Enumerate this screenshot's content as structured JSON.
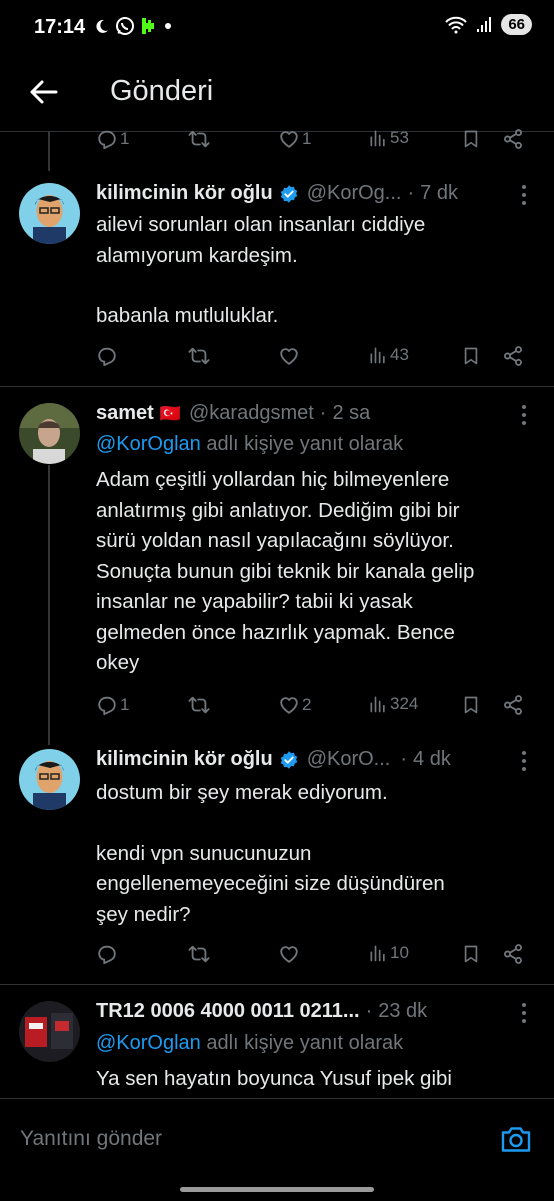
{
  "status_bar": {
    "time": "17:14",
    "battery": "66"
  },
  "header": {
    "title": "Gönderi"
  },
  "top_actions": {
    "replies": "1",
    "likes": "1",
    "views": "53"
  },
  "tweets": [
    {
      "name": "kilimcinin kör oğlu",
      "handle": "@KorOg...",
      "time": "7 dk",
      "verified": true,
      "body": [
        "ailevi sorunları olan insanları ciddiye",
        "alamıyorum kardeşim.",
        "",
        "babanla mutluluklar."
      ],
      "replies": "",
      "reposts": "",
      "likes": "",
      "views": "43"
    },
    {
      "name": "samet",
      "flag": "🇹🇷",
      "handle": "@karadgsmet",
      "time": "2 sa",
      "reply_to_mention": "@KorOglan",
      "reply_to_suffix": "adlı kişiye yanıt olarak",
      "body": [
        "Adam çeşitli yollardan hiç bilmeyenlere",
        "anlatırmış gibi anlatıyor. Dediğim gibi bir",
        "sürü yoldan nasıl yapılacağını söylüyor.",
        "Sonuçta bunun gibi teknik bir kanala gelip",
        "insanlar ne yapabilir? tabii ki yasak",
        "gelmeden önce hazırlık yapmak. Bence",
        "okey"
      ],
      "replies": "1",
      "reposts": "",
      "likes": "2",
      "views": "324"
    },
    {
      "name": "kilimcinin kör oğlu",
      "handle": "@KorO...",
      "time": "4 dk",
      "verified": true,
      "body": [
        "dostum bir şey merak ediyorum.",
        "",
        "kendi vpn sunucunuzun",
        "engellenemeyeceğini size düşündüren",
        "şey nedir?"
      ],
      "replies": "",
      "reposts": "",
      "likes": "",
      "views": "10"
    },
    {
      "name": "TR12 0006 4000 0011 0211...",
      "time": "23 dk",
      "reply_to_mention": "@KorOglan",
      "reply_to_suffix": "adlı kişiye yanıt olarak",
      "body": [
        "Ya sen hayatın boyunca Yusuf ipek gibi"
      ]
    }
  ],
  "composer": {
    "placeholder": "Yanıtını gönder"
  },
  "colors": {
    "background": "#000000",
    "text": "#e7e9ea",
    "muted": "#71767b",
    "accent": "#1d9bf0",
    "divider": "#2f3336"
  },
  "icons": [
    "moon-icon",
    "whatsapp-icon",
    "kick-icon",
    "wifi-icon",
    "signal-icon",
    "back-arrow-icon",
    "reply-icon",
    "repost-icon",
    "like-icon",
    "views-icon",
    "bookmark-icon",
    "share-icon",
    "verified-badge-icon",
    "more-icon",
    "camera-icon"
  ]
}
